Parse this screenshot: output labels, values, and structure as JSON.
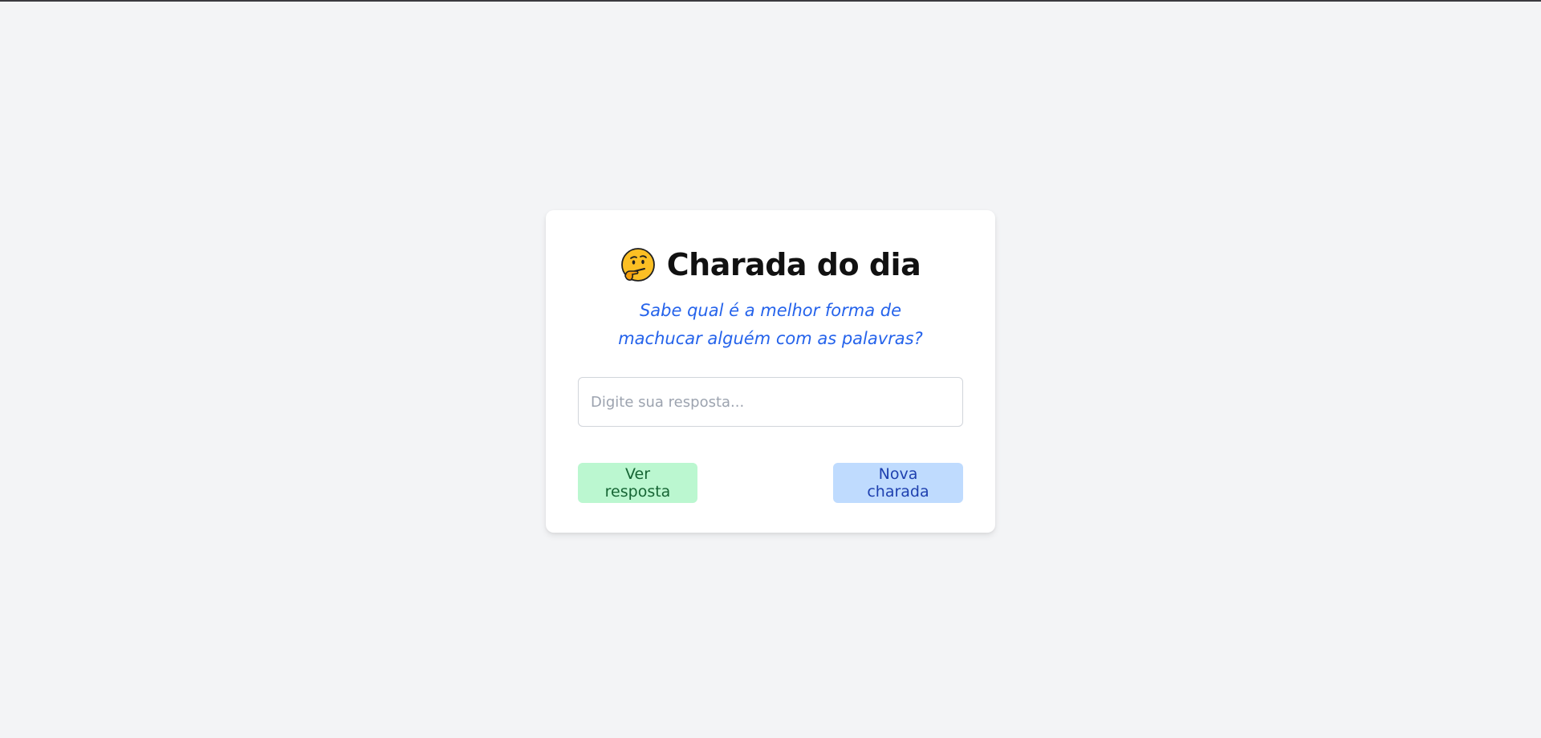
{
  "card": {
    "title": "Charada do dia",
    "title_icon": "thinking-face-icon",
    "riddle": "Sabe qual é a melhor forma de machucar alguém com as palavras?",
    "answer_placeholder": "Digite sua resposta...",
    "answer_value": "",
    "reveal_label": "Ver resposta",
    "new_label": "Nova charada"
  },
  "colors": {
    "page_bg": "#f3f4f6",
    "riddle_text": "#2563eb",
    "reveal_bg": "#bbf7d0",
    "reveal_text": "#166534",
    "new_bg": "#bfdbfe",
    "new_text": "#1e40af"
  }
}
